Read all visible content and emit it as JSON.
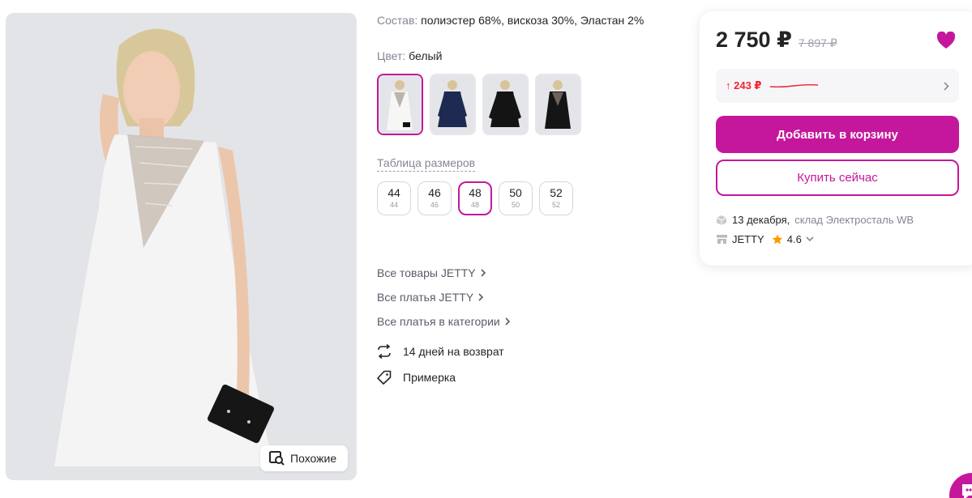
{
  "gallery": {
    "similar_label": "Похожие"
  },
  "details": {
    "composition_label": "Состав:",
    "composition_value": "полиэстер 68%, вискоза 30%, Эластан 2%",
    "color_label": "Цвет:",
    "color_value": "белый",
    "size_table_link": "Таблица размеров",
    "sizes": [
      {
        "label": "44",
        "sub": "44"
      },
      {
        "label": "46",
        "sub": "46"
      },
      {
        "label": "48",
        "sub": "48"
      },
      {
        "label": "50",
        "sub": "50"
      },
      {
        "label": "52",
        "sub": "52"
      }
    ],
    "selected_size": "48",
    "links": [
      "Все товары JETTY",
      "Все платья JETTY",
      "Все платья в категории"
    ],
    "features": [
      {
        "icon": "return-arrows-icon",
        "text": "14 дней на возврат"
      },
      {
        "icon": "tag-icon",
        "text": "Примерка"
      }
    ]
  },
  "buy_box": {
    "price": "2 750 ₽",
    "old_price": "7 897 ₽",
    "price_drop": "↑ 243 ₽",
    "add_to_cart": "Добавить в корзину",
    "buy_now": "Купить сейчас",
    "delivery_date": "13 декабря,",
    "warehouse": "склад Электросталь WB",
    "seller_name": "JETTY",
    "rating": "4.6"
  },
  "colors": {
    "accent": "#c5179c",
    "price_drop": "#f5222d",
    "star": "#ff9800"
  }
}
